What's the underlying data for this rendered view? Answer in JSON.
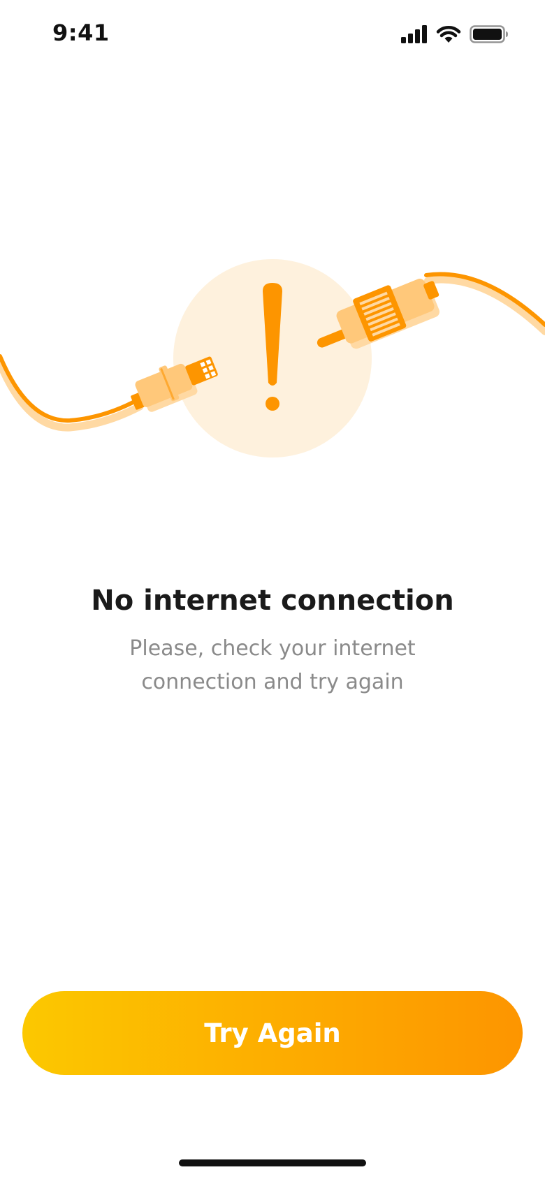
{
  "status_bar": {
    "time": "9:41",
    "icons": [
      "cellular-signal-icon",
      "wifi-icon",
      "battery-icon"
    ]
  },
  "illustration": {
    "icon": "disconnected-cable-icon",
    "symbol": "!"
  },
  "message": {
    "title": "No internet connection",
    "subtitle": "Please, check your internet connection and try again"
  },
  "actions": {
    "try_again_label": "Try Again"
  },
  "colors": {
    "accent": "#FD9500",
    "accent_start": "#FCC800",
    "accent_light": "#FFC87A",
    "circle_background": "#FEF1DD",
    "title_text": "#1A1A1A",
    "subtitle_text": "#8A8A8A"
  }
}
